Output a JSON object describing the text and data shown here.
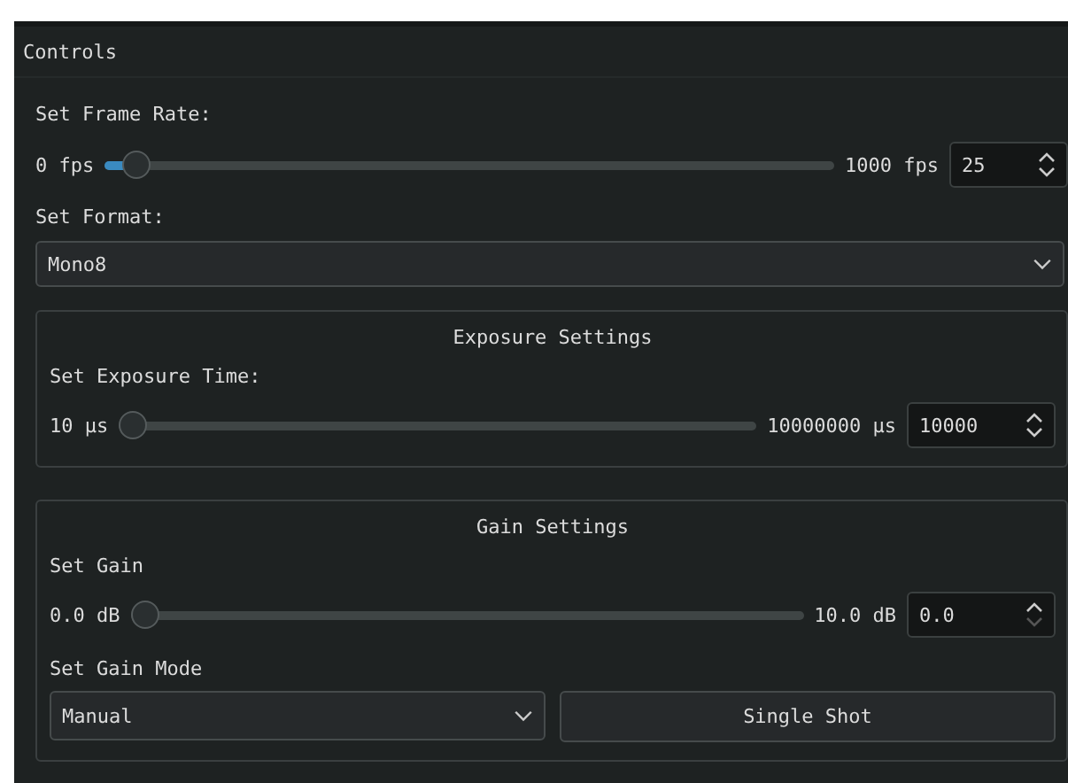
{
  "panel": {
    "title": "Controls"
  },
  "frame_rate": {
    "label": "Set Frame Rate:",
    "min_label": "0 fps",
    "max_label": "1000 fps",
    "level": 0.025,
    "value": "25",
    "up_enabled": true,
    "down_enabled": true
  },
  "format": {
    "label": "Set Format:",
    "value": "Mono8"
  },
  "exposure": {
    "title": "Exposure Settings",
    "label": "Set Exposure Time:",
    "min_label": "10 µs",
    "max_label": "10000000 µs",
    "level": 0.0,
    "value": "10000",
    "up_enabled": true,
    "down_enabled": true
  },
  "gain": {
    "title": "Gain Settings",
    "label": "Set Gain",
    "min_label": "0.0 dB",
    "max_label": "10.0 dB",
    "level": 0.0,
    "value": "0.0",
    "up_enabled": true,
    "down_enabled": false,
    "mode_label": "Set Gain Mode",
    "mode_value": "Manual",
    "button": "Single Shot"
  }
}
